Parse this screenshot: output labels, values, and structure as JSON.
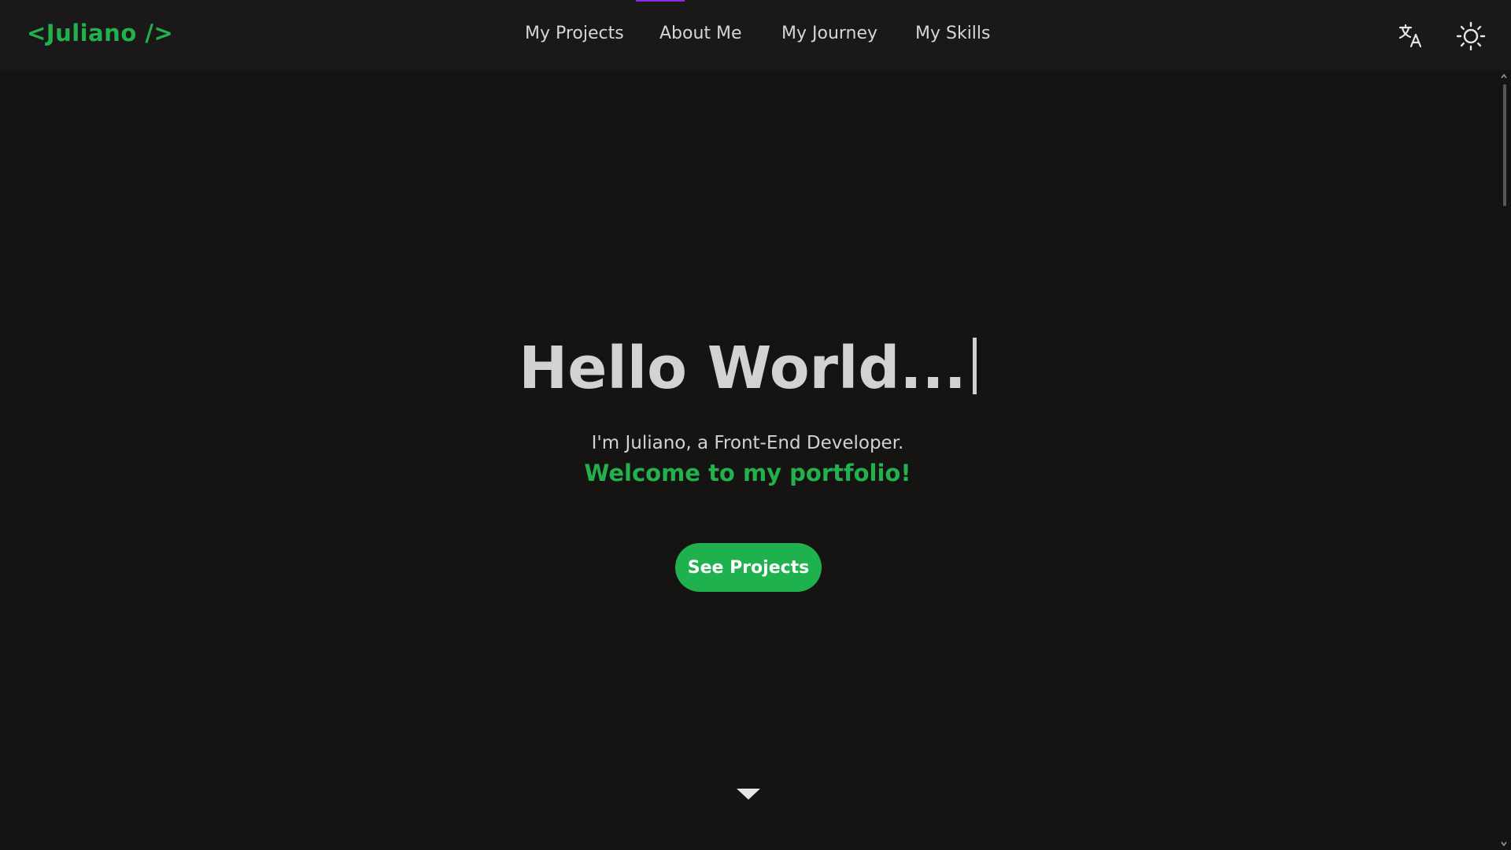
{
  "header": {
    "logo": "<Juliano />",
    "nav": [
      {
        "label": "My Projects"
      },
      {
        "label": "About Me"
      },
      {
        "label": "My Journey"
      },
      {
        "label": "My Skills"
      }
    ],
    "translate_icon": "translate-icon",
    "theme_icon": "sun-icon"
  },
  "hero": {
    "title": "Hello World...",
    "subtitle": "I'm Juliano, a Front-End Developer.",
    "welcome": "Welcome to my portfolio!",
    "cta_label": "See Projects",
    "scroll_icon": "caret-down-icon"
  },
  "colors": {
    "background": "#161313",
    "navbar": "#1a1818",
    "accent_green": "#22b14c",
    "text": "#d2d2d2",
    "nav_indicator": "#8a2be2"
  }
}
